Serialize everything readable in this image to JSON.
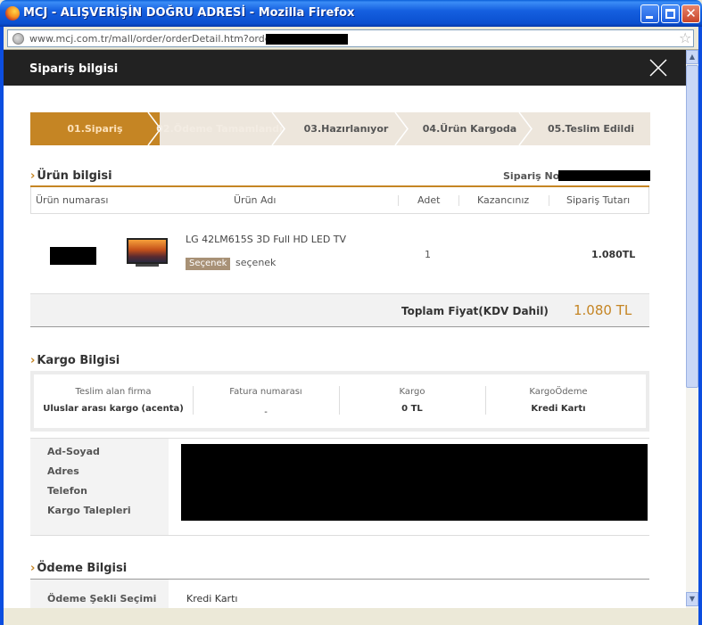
{
  "window": {
    "title": "MCJ - ALIŞVERİŞİN DOĞRU ADRESİ - Mozilla Firefox",
    "url": "www.mcj.com.tr/mall/order/orderDetail.htm?orderNo="
  },
  "modal": {
    "title": "Sipariş bilgisi"
  },
  "steps": [
    {
      "label": "01.Sipariş",
      "active": true
    },
    {
      "label": "02.Ödeme Tamamlandı",
      "active": false
    },
    {
      "label": "03.Hazırlanıyor",
      "active": false
    },
    {
      "label": "04.Ürün Kargoda",
      "active": false
    },
    {
      "label": "05.Teslim Edildi",
      "active": false
    }
  ],
  "product_section": {
    "title": "Ürün bilgisi",
    "order_no_label": "Sipariş No",
    "columns": [
      "Ürün numarası",
      "Ürün Adı",
      "Adet",
      "Kazancınız",
      "Sipariş Tutarı"
    ],
    "item": {
      "name": "LG 42LM615S 3D Full HD LED TV",
      "option_badge": "Seçenek",
      "option_value": "seçenek",
      "quantity": "1",
      "earning": "",
      "total": "1.080TL"
    },
    "total_label": "Toplam Fiyat(KDV Dahil)",
    "total_value": "1.080 TL"
  },
  "shipping_section": {
    "title": "Kargo Bilgisi",
    "columns": [
      {
        "label": "Teslim alan firma",
        "value": "Uluslar arası kargo (acenta)"
      },
      {
        "label": "Fatura numarası",
        "value": "-"
      },
      {
        "label": "Kargo",
        "value": "0 TL"
      },
      {
        "label": "KargoÖdeme",
        "value": "Kredi Kartı"
      }
    ],
    "address_labels": [
      "Ad-Soyad",
      "Adres",
      "Telefon",
      "Kargo Talepleri"
    ]
  },
  "payment_section": {
    "title": "Ödeme Bilgisi",
    "method_label": "Ödeme Şekli Seçimi",
    "method_value": "Kredi Kartı"
  },
  "colors": {
    "accent": "#c58524",
    "header_bg": "#222222",
    "steps_bg": "#ede6dc"
  }
}
